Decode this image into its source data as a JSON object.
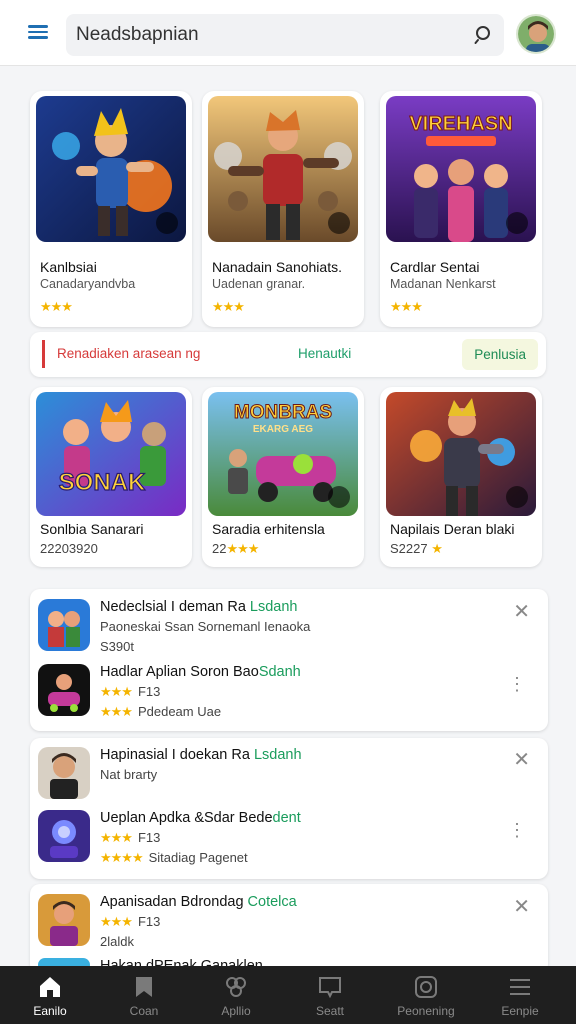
{
  "header": {
    "search_text": "Neadsbapnian",
    "menu_icon": "menu-icon",
    "search_icon": "search-icon",
    "avatar": "avatar"
  },
  "row1": [
    {
      "title": "Kanlbsiai",
      "sub": "Canadaryandvba",
      "stars": "★★★"
    },
    {
      "title": "Nanadain Sanohiats.",
      "sub": "Uadenan granar.",
      "stars": "★★★"
    },
    {
      "title": "Cardlar Sentai",
      "sub": "Madanan Nenkarst",
      "stars": "★★★",
      "thumb_text": "VIREHASN"
    }
  ],
  "filters": {
    "left": "Renadiaken arasean ng",
    "middle": "Henautki",
    "right": "Penlusia"
  },
  "row2": [
    {
      "title": "Sonlbia Sanarari",
      "num": "22203920",
      "thumb_text": "SONAK"
    },
    {
      "title": "Saradia erhitensla",
      "num": "22",
      "stars": "★★★"
    },
    {
      "title": "Napilais Deran blaki",
      "num": "S2227",
      "stars": "★"
    }
  ],
  "row2_thumb_text": "MONBRAS",
  "row2_thumb_sub": "EKARG AEG",
  "list1": [
    {
      "name": "Nedeclsial I deman Ra",
      "name_green": "Lsdanh",
      "line2": "Paoneskai Ssan Sornemanl Ienaoka",
      "line3": "S390t"
    },
    {
      "name": "Hadlar Aplian Soron Bao",
      "name_green": "Sdanh",
      "line2": "F13",
      "line3": "Pdedeam Uae",
      "stars2": "★★★",
      "stars3": "★★★"
    }
  ],
  "list2": [
    {
      "name": "Hapinasial I doekan Ra",
      "name_green": "Lsdanh",
      "line2": "Nat brarty"
    },
    {
      "name": "Ueplan Apdka &Sdar Bede",
      "name_green": "dent",
      "line2": "F13",
      "line3": "Sitadiag Pagenet",
      "stars2": "★★★",
      "stars3": "★★★★"
    }
  ],
  "list3": [
    {
      "name": "Apanisadan Bdrondag",
      "name_green": "Cotelca",
      "line2": "F13",
      "line3": "2laldk",
      "stars2": "★★★"
    },
    {
      "name": "Hakan dPEnak Ganaklen"
    }
  ],
  "nav": [
    {
      "label": "Eanilo",
      "icon": "home-icon",
      "active": true
    },
    {
      "label": "Coan",
      "icon": "bookmark-icon",
      "active": false
    },
    {
      "label": "Apllio",
      "icon": "apps-icon",
      "active": false
    },
    {
      "label": "Seatt",
      "icon": "chat-icon",
      "active": false
    },
    {
      "label": "Peonening",
      "icon": "camera-icon",
      "active": false
    },
    {
      "label": "Eenpie",
      "icon": "list-icon",
      "active": false
    }
  ],
  "colors": {
    "accent_blue": "#1f6fb2",
    "filter_red": "#d63a3a",
    "green": "#1a9c5c",
    "star": "#f4b400",
    "nav_bg": "#1f1f1f"
  }
}
